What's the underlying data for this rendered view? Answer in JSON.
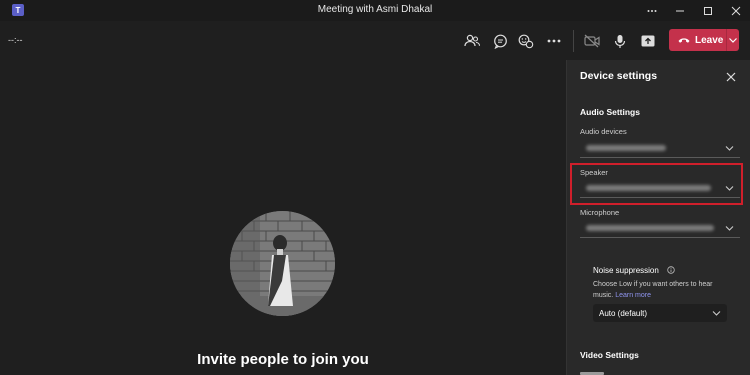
{
  "window": {
    "title": "Meeting with Asmi Dhakal",
    "app_logo_letter": "T",
    "controls": [
      "more-icon",
      "minimize-icon",
      "maximize-icon",
      "close-icon"
    ]
  },
  "toolbar": {
    "timer": "--:--",
    "icons": [
      "people-icon",
      "chat-icon",
      "reactions-icon",
      "more-actions-icon",
      "camera-off-icon",
      "microphone-icon",
      "share-tray-icon"
    ],
    "leave_label": "Leave",
    "leave_color": "#c4314b"
  },
  "stage": {
    "invite_text": "Invite people to join you"
  },
  "device_settings": {
    "title": "Device settings",
    "audio_section": "Audio Settings",
    "audio_devices_label": "Audio devices",
    "speaker_label": "Speaker",
    "microphone_label": "Microphone",
    "noise_suppression_label": "Noise suppression",
    "noise_desc": "Choose Low if you want others to hear music.",
    "learn_more": "Learn more",
    "noise_value": "Auto (default)",
    "video_section": "Video Settings",
    "highlight_color": "#d01f2b"
  }
}
